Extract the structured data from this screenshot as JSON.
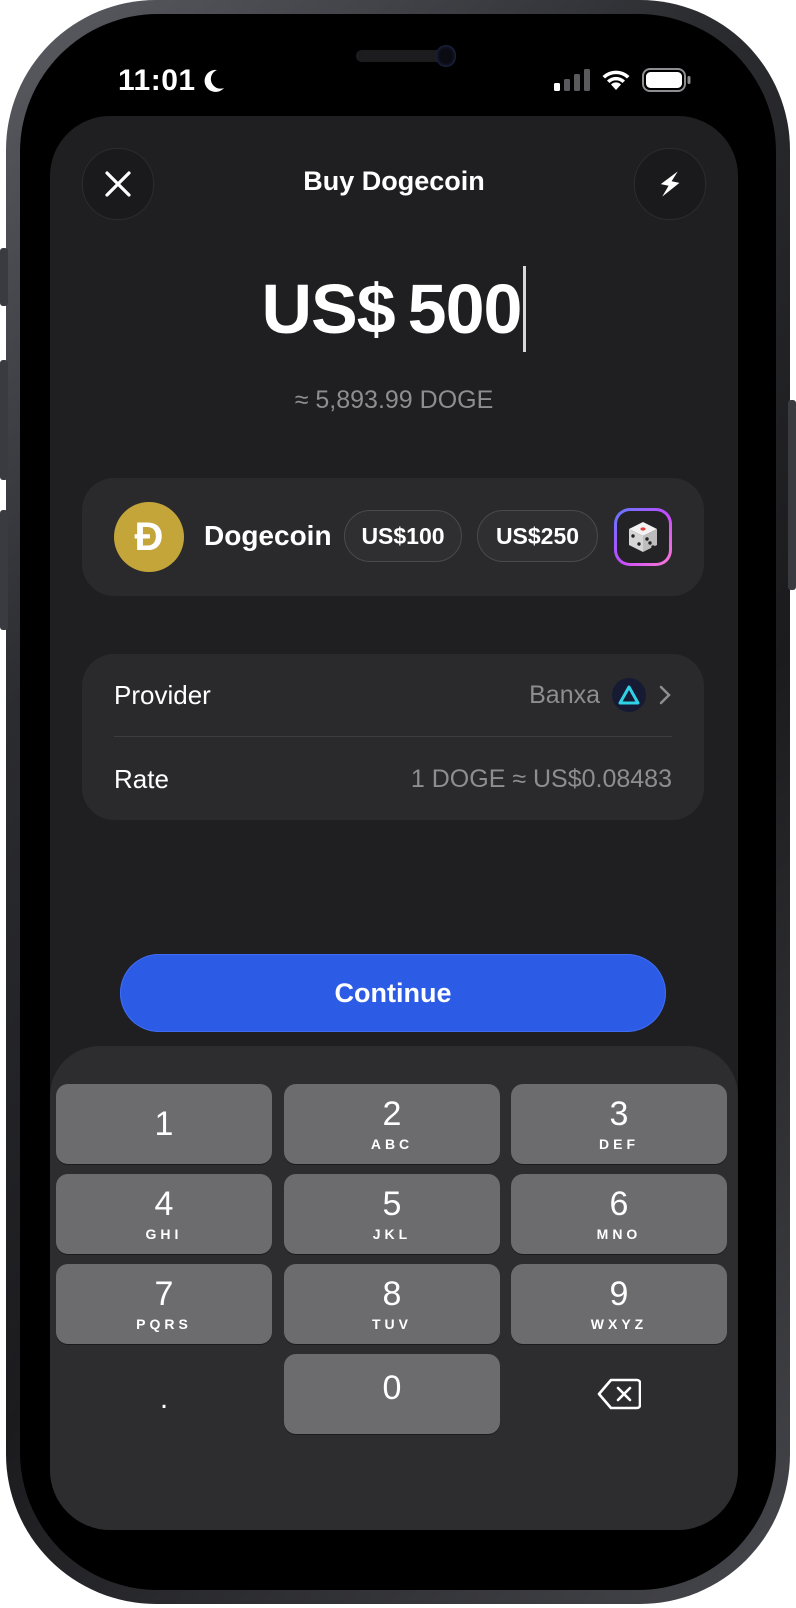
{
  "status_bar": {
    "time": "11:01"
  },
  "header": {
    "title": "Buy Dogecoin",
    "close_icon": "close-icon",
    "quick_icon": "lightning-icon"
  },
  "amount": {
    "value": "US$ 500",
    "converted": "≈ 5,893.99 DOGE"
  },
  "asset": {
    "symbol_glyph": "Đ",
    "name": "Dogecoin",
    "presets": [
      "US$100",
      "US$250"
    ],
    "random_icon": "dice-icon",
    "coin_color": "#c4a53a"
  },
  "details": {
    "provider_label": "Provider",
    "provider_value": "Banxa",
    "rate_label": "Rate",
    "rate_value": "1 DOGE ≈ US$0.08483"
  },
  "continue_label": "Continue",
  "accent_color": "#2c5be6",
  "keypad": {
    "keys": [
      {
        "digit": "1",
        "letters": ""
      },
      {
        "digit": "2",
        "letters": "ABC"
      },
      {
        "digit": "3",
        "letters": "DEF"
      },
      {
        "digit": "4",
        "letters": "GHI"
      },
      {
        "digit": "5",
        "letters": "JKL"
      },
      {
        "digit": "6",
        "letters": "MNO"
      },
      {
        "digit": "7",
        "letters": "PQRS"
      },
      {
        "digit": "8",
        "letters": "TUV"
      },
      {
        "digit": "9",
        "letters": "WXYZ"
      },
      {
        "digit": ".",
        "letters": ""
      },
      {
        "digit": "0",
        "letters": ""
      }
    ],
    "delete_icon": "backspace-icon"
  }
}
